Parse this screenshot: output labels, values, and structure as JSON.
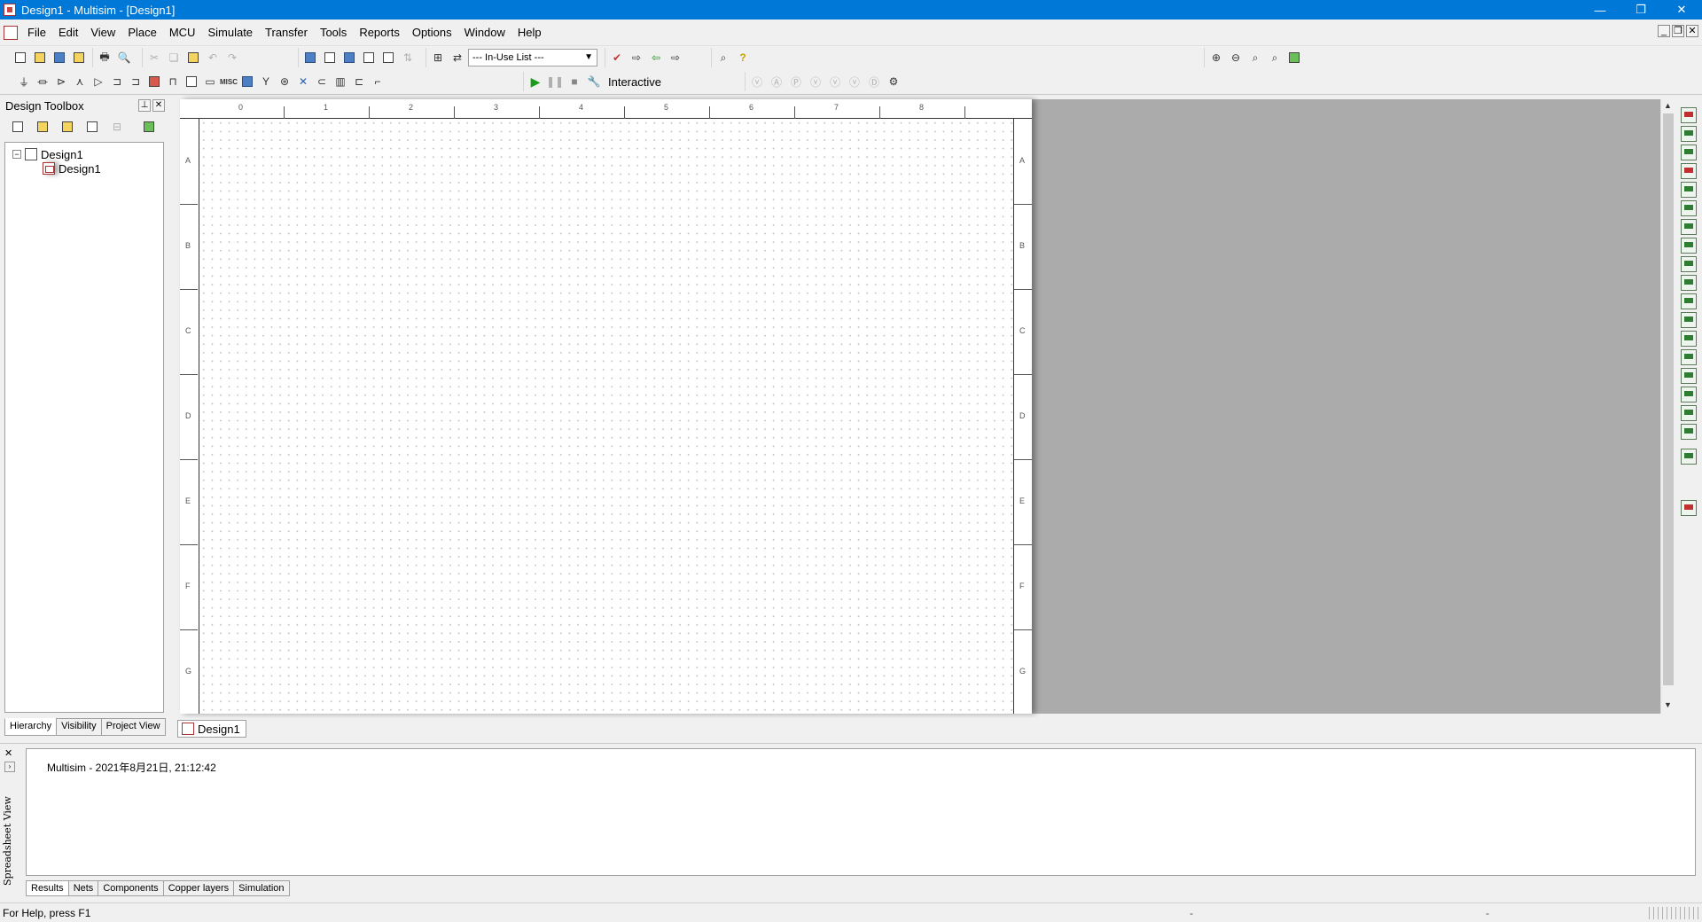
{
  "window": {
    "title": "Design1 - Multisim - [Design1]",
    "minimize": "—",
    "restore": "❐",
    "close": "✕"
  },
  "menu": {
    "items": [
      "File",
      "Edit",
      "View",
      "Place",
      "MCU",
      "Simulate",
      "Transfer",
      "Tools",
      "Reports",
      "Options",
      "Window",
      "Help"
    ]
  },
  "toolbar": {
    "in_use_list": "--- In-Use List ---",
    "interactive_label": "Interactive"
  },
  "toolbox": {
    "title": "Design Toolbox",
    "tree": {
      "root": "Design1",
      "child": "Design1"
    },
    "tabs": [
      "Hierarchy",
      "Visibility",
      "Project View"
    ]
  },
  "sheet": {
    "columns": [
      "0",
      "1",
      "2",
      "3",
      "4",
      "5",
      "6",
      "7",
      "8"
    ],
    "rows": [
      "A",
      "B",
      "C",
      "D",
      "E",
      "F",
      "G"
    ],
    "tab_label": "Design1"
  },
  "spreadsheet": {
    "side_label": "Spreadsheet View",
    "log_line": "Multisim  -  2021年8月21日, 21:12:42",
    "tabs": [
      "Results",
      "Nets",
      "Components",
      "Copper layers",
      "Simulation"
    ]
  },
  "status": {
    "help": "For Help, press F1",
    "seg1": "-",
    "seg2": "-"
  },
  "colors": {
    "titlebar": "#0078d7",
    "workspace": "#ababab"
  }
}
